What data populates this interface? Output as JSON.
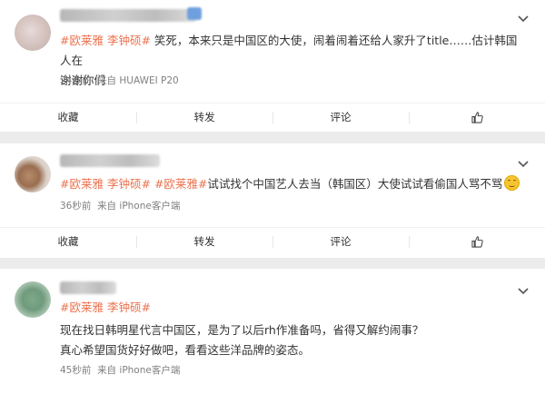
{
  "actions": {
    "favorite": "收藏",
    "repost": "转发",
    "comment": "评论"
  },
  "posts": [
    {
      "tags": [
        "#欧莱雅",
        "李钟硕#"
      ],
      "text_line1": " 笑死，本来只是中国区的大使，闹着闹着还给人家升了title……估计韩国人在",
      "text_line2": "谢谢你们",
      "time": "24秒前",
      "source": "来自 HUAWEI P20"
    },
    {
      "tags": [
        "#欧莱雅",
        "李钟硕#",
        "#欧莱雅#"
      ],
      "text": "试试找个中国艺人去当（韩国区）大使试试看偷国人骂不骂",
      "time": "36秒前",
      "source": "来自 iPhone客户端"
    },
    {
      "tags": [
        "#欧莱雅",
        "李钟硕#"
      ],
      "text_line1": "现在找日韩明星代言中国区，是为了以后rh作准备吗，省得又解约闹事？",
      "text_line2": "真心希望国货好好做吧，看看这些洋品牌的姿态。",
      "time": "45秒前",
      "source": "来自 iPhone客户端"
    }
  ],
  "colors": {
    "tag": "#eb7350",
    "meta": "#808080",
    "background": "#ececec"
  },
  "icons": {
    "like": "thumbs-up-icon",
    "more": "chevron-down-icon"
  }
}
